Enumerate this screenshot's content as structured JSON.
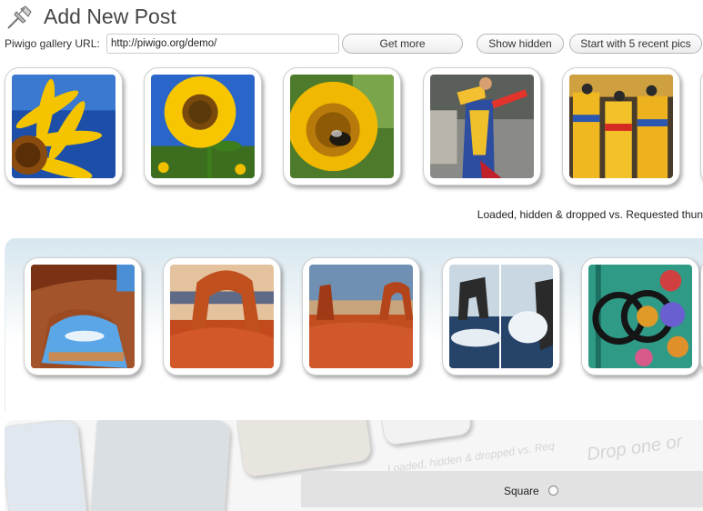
{
  "header": {
    "title": "Add New Post",
    "icon": "pushpin-icon"
  },
  "form": {
    "url_label": "Piwigo gallery URL:",
    "url_value": "http://piwigo.org/demo/",
    "get_more_label": "Get more",
    "show_hidden_label": "Show hidden",
    "recent_label": "Start with 5 recent pics"
  },
  "status": {
    "text": "Loaded, hidden & dropped vs. Requested thun"
  },
  "options": {
    "square_label": "Square",
    "square_checked": false
  },
  "watermark": {
    "text1": "Loaded, hidden & dropped vs. Req",
    "text2": "Drop one or"
  },
  "row1": [
    {
      "name": "sunflower-sky-thumb"
    },
    {
      "name": "sunflower-field-thumb"
    },
    {
      "name": "sunflower-bee-thumb"
    },
    {
      "name": "dancer-thumb"
    },
    {
      "name": "parade-thumb"
    }
  ],
  "row2": [
    {
      "name": "rock-arch-thumb"
    },
    {
      "name": "delicate-arch-thumb"
    },
    {
      "name": "desert-arch-thumb"
    },
    {
      "name": "sea-stack-thumb"
    },
    {
      "name": "door-knocker-thumb"
    }
  ],
  "colors": {
    "text": "#464646",
    "border": "#cfcfcf",
    "band": "#d6e6ef"
  }
}
